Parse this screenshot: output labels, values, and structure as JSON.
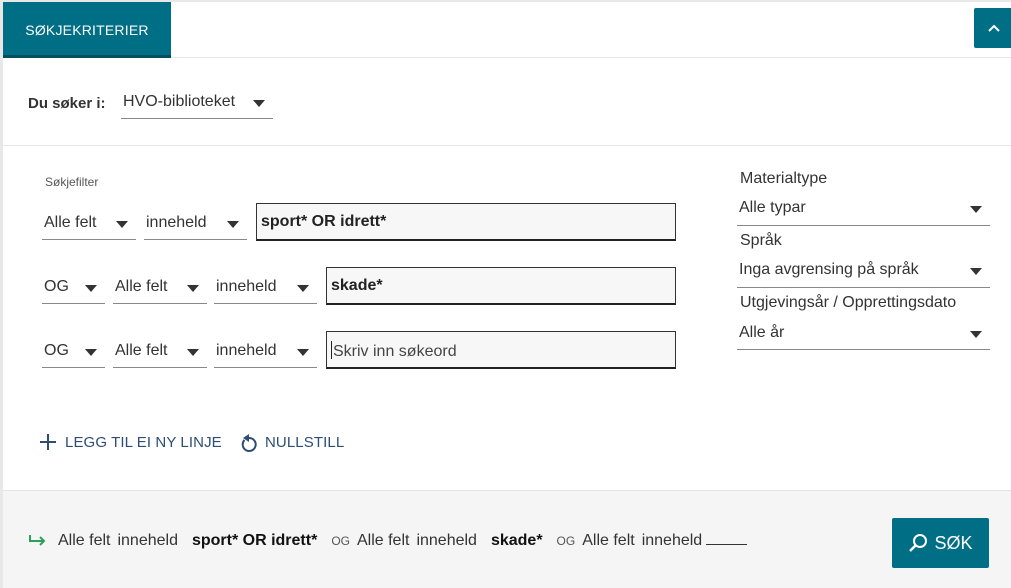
{
  "tabs": {
    "search_criteria": "SØKJEKRITERIER"
  },
  "icons": {
    "collapse": "chevron-up-icon",
    "add": "plus-icon",
    "reset": "reset-icon",
    "summary": "arrow-right-icon",
    "search": "magnifier-icon"
  },
  "colors": {
    "accent": "#006e85",
    "link": "#2d4d75",
    "summary_arrow": "#2aa05a"
  },
  "scope": {
    "label": "Du søker i:",
    "value": "HVO-biblioteket"
  },
  "filters": {
    "title": "Søkjefilter",
    "rows": [
      {
        "field": "Alle felt",
        "condition": "inneheld",
        "value": "sport* OR idrett*"
      },
      {
        "operator": "OG",
        "field": "Alle felt",
        "condition": "inneheld",
        "value": "skade*"
      },
      {
        "operator": "OG",
        "field": "Alle felt",
        "condition": "inneheld",
        "placeholder": "Skriv inn søkeord"
      }
    ]
  },
  "sidebar": {
    "material": {
      "label": "Materialtype",
      "value": "Alle typar"
    },
    "language": {
      "label": "Språk",
      "value": "Inga avgrensing på språk"
    },
    "year": {
      "label": "Utgjevingsår / Opprettingsdato",
      "value": "Alle år"
    }
  },
  "actions": {
    "add_line": "LEGG TIL EI NY LINJE",
    "reset": "NULLSTILL"
  },
  "summary": {
    "parts": [
      {
        "field": "Alle felt",
        "condition": "inneheld",
        "value": "sport* OR idrett*"
      },
      {
        "operator": "OG",
        "field": "Alle felt",
        "condition": "inneheld",
        "value": "skade*"
      },
      {
        "operator": "OG",
        "field": "Alle felt",
        "condition": "inneheld"
      }
    ]
  },
  "search_button": {
    "label": "SØK"
  }
}
